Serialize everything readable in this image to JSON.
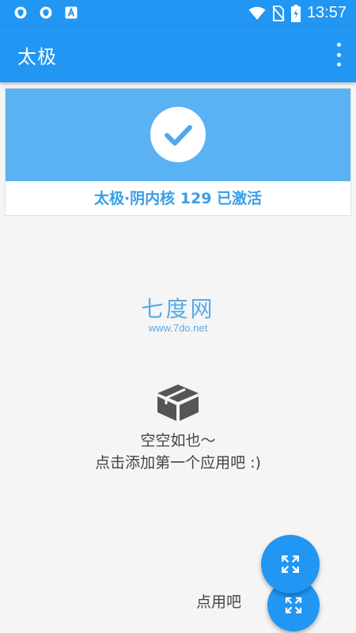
{
  "status_bar": {
    "time": "13:57",
    "left_icons": [
      "shield-icon",
      "shield-icon",
      "font-a-icon"
    ],
    "right_icons": [
      "wifi-icon",
      "no-sim-icon",
      "battery-charging-icon"
    ]
  },
  "app_bar": {
    "title": "太极",
    "overflow_icon": "more-vert-icon"
  },
  "status_card": {
    "icon": "check-icon",
    "text": "太极·阴内核 129 已激活"
  },
  "watermark": {
    "name": "七度网",
    "url": "www.7do.net"
  },
  "empty_state": {
    "icon": "box-icon",
    "line1": "空空如也～",
    "line2": "点击添加第一个应用吧 :)"
  },
  "fab": {
    "icon": "expand-icon",
    "label": "点用吧"
  },
  "colors": {
    "primary": "#2196f3",
    "banner": "#5ab2f3",
    "status_text": "#3a9ee6",
    "watermark": "#58aae8",
    "body_text": "#444444",
    "background": "#f5f5f5"
  }
}
